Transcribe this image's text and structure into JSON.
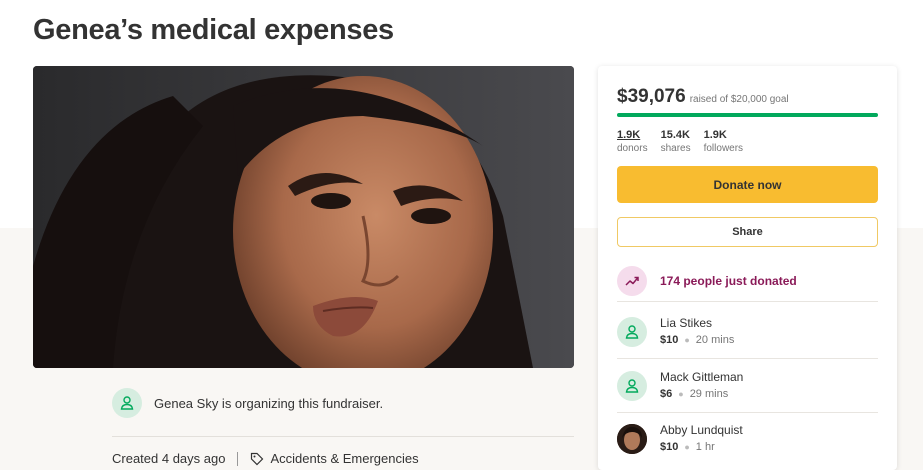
{
  "campaign": {
    "title": "Genea’s medical expenses",
    "organizer_text": "Genea Sky is organizing this fundraiser.",
    "created": "Created 4 days ago",
    "category": "Accidents & Emergencies"
  },
  "summary": {
    "amount_raised": "$39,076",
    "goal_text": "raised of $20,000 goal",
    "progress_fraction": 1.0,
    "stats": [
      {
        "value": "1.9K",
        "label": "donors"
      },
      {
        "value": "15.4K",
        "label": "shares"
      },
      {
        "value": "1.9K",
        "label": "followers"
      }
    ]
  },
  "actions": {
    "donate_label": "Donate now",
    "share_label": "Share"
  },
  "activity": {
    "just_donated": "174 people just donated"
  },
  "donors": [
    {
      "name": "Lia Stikes",
      "amount": "$10",
      "time": "20 mins",
      "avatar": "user-icon"
    },
    {
      "name": "Mack Gittleman",
      "amount": "$6",
      "time": "29 mins",
      "avatar": "user-icon"
    },
    {
      "name": "Abby Lundquist",
      "amount": "$10",
      "time": "1 hr",
      "avatar": "photo"
    }
  ],
  "colors": {
    "progress": "#02a95c",
    "donate_button": "#f8bc30",
    "trend_text": "#8a1a58",
    "icon_green": "#02a95c"
  }
}
